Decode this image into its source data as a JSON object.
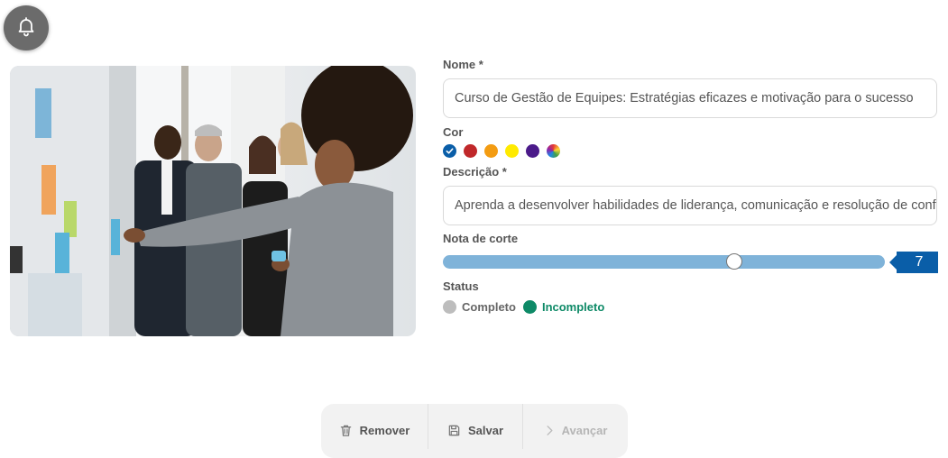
{
  "notification": {
    "icon": "bell-icon"
  },
  "form": {
    "name": {
      "label": "Nome *",
      "value": "Curso de Gestão de Equipes: Estratégias eficazes e motivação para o sucesso"
    },
    "color": {
      "label": "Cor",
      "options": [
        {
          "name": "blue",
          "hex": "#0a5ea8",
          "selected": true
        },
        {
          "name": "red",
          "hex": "#c0282a"
        },
        {
          "name": "orange",
          "hex": "#f39c12"
        },
        {
          "name": "yellow",
          "hex": "#ffea00"
        },
        {
          "name": "purple",
          "hex": "#4b1a8a"
        },
        {
          "name": "multicolor",
          "hex": "rainbow"
        }
      ]
    },
    "description": {
      "label": "Descrição *",
      "value": "Aprenda a desenvolver habilidades de liderança, comunicação e resolução de conflitos"
    },
    "cutoff": {
      "label": "Nota de corte",
      "value": "7",
      "level_fraction": 0.66
    },
    "status": {
      "label": "Status",
      "options": [
        {
          "label": "Completo",
          "color": "#bdbdbd",
          "active": false
        },
        {
          "label": "Incompleto",
          "color": "#0e8a67",
          "active": true
        }
      ]
    }
  },
  "toolbar": {
    "remove_label": "Remover",
    "save_label": "Salvar",
    "next_label": "Avançar"
  }
}
